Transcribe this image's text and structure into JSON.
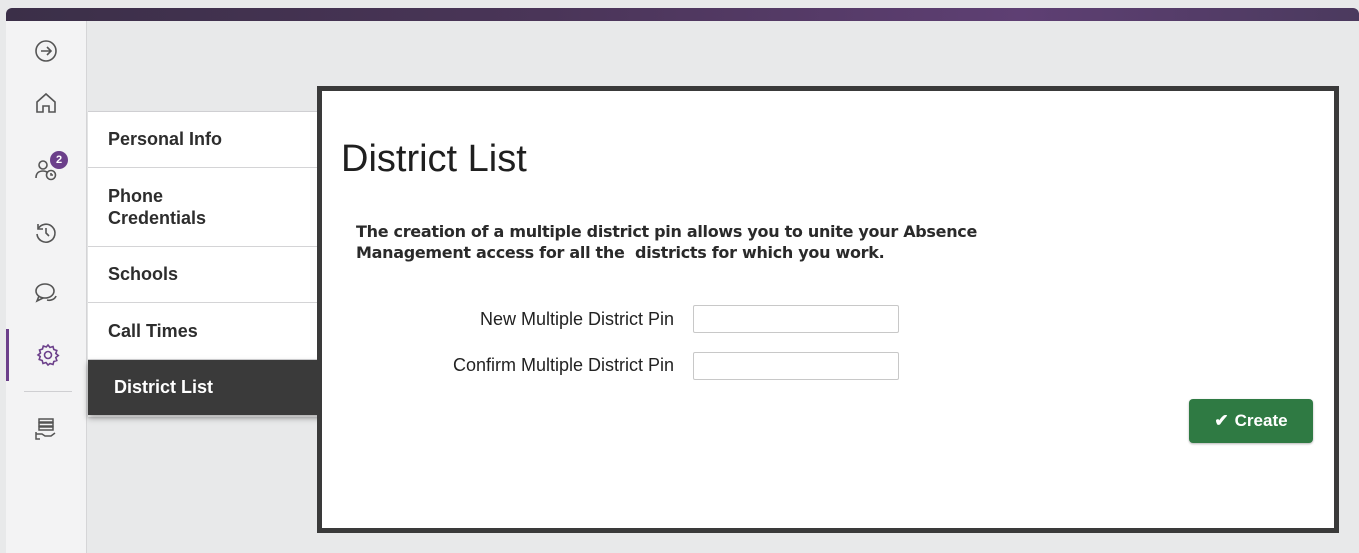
{
  "nav_rail": {
    "items": [
      {
        "icon": "arrow-right-circle-icon"
      },
      {
        "icon": "home-icon"
      },
      {
        "icon": "user-clock-icon",
        "badge": "2"
      },
      {
        "icon": "history-icon"
      },
      {
        "icon": "chat-icon"
      },
      {
        "icon": "gear-icon",
        "active": true
      },
      {
        "icon": "hand-stack-icon"
      }
    ]
  },
  "settings_menu": {
    "items": [
      {
        "label": "Personal Info"
      },
      {
        "label": "Phone\nCredentials"
      },
      {
        "label": "Schools"
      },
      {
        "label": "Call Times"
      },
      {
        "label": "District List",
        "active": true
      }
    ]
  },
  "main": {
    "title": "District List",
    "description_line1": "The creation of a multiple district pin allows you to unite your Absence",
    "description_line2": "Management access for all the  districts for which you work.",
    "fields": [
      {
        "label": "New Multiple District Pin",
        "value": ""
      },
      {
        "label": "Confirm Multiple District Pin",
        "value": ""
      }
    ],
    "create_button": {
      "icon": "checkmark",
      "label": "Create"
    }
  },
  "colors": {
    "brand_purple": "#5e3f73",
    "active_menu_bg": "#3a3a3a",
    "create_green": "#2f7a43"
  }
}
